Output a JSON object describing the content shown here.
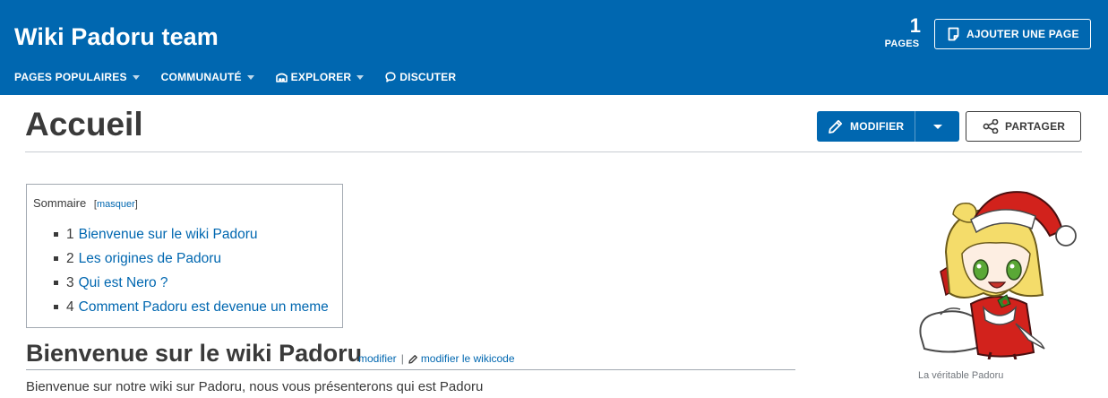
{
  "header": {
    "wiki_name": "Wiki Padoru team",
    "pages_count": "1",
    "pages_label": "PAGES",
    "add_page_label": "AJOUTER UNE PAGE",
    "nav": [
      {
        "label": "PAGES POPULAIRES",
        "has_dropdown": true,
        "icon": ""
      },
      {
        "label": "COMMUNAUTÉ",
        "has_dropdown": true,
        "icon": ""
      },
      {
        "label": "EXPLORER",
        "has_dropdown": true,
        "icon": "explore-icon"
      },
      {
        "label": "DISCUTER",
        "has_dropdown": false,
        "icon": "discuss-icon"
      }
    ]
  },
  "page": {
    "title": "Accueil",
    "edit_label": "MODIFIER",
    "share_label": "PARTAGER"
  },
  "toc": {
    "heading": "Sommaire",
    "toggle_label": "masquer",
    "items": [
      {
        "number": "1",
        "text": "Bienvenue sur le wiki Padoru"
      },
      {
        "number": "2",
        "text": "Les origines de Padoru"
      },
      {
        "number": "3",
        "text": "Qui est Nero ?"
      },
      {
        "number": "4",
        "text": "Comment Padoru est devenue un meme"
      }
    ]
  },
  "section": {
    "title": "Bienvenue sur le wiki Padoru",
    "edit_label": "modifier",
    "separator": "|",
    "edit_source_label": "modifier le wikicode",
    "body": "Bienvenue sur notre wiki sur Padoru, nous vous présenterons qui est Padoru"
  },
  "figure": {
    "caption": "La véritable Padoru"
  },
  "colors": {
    "brand": "#0067b0",
    "text": "#3a3a3a",
    "link": "#0067b0"
  }
}
